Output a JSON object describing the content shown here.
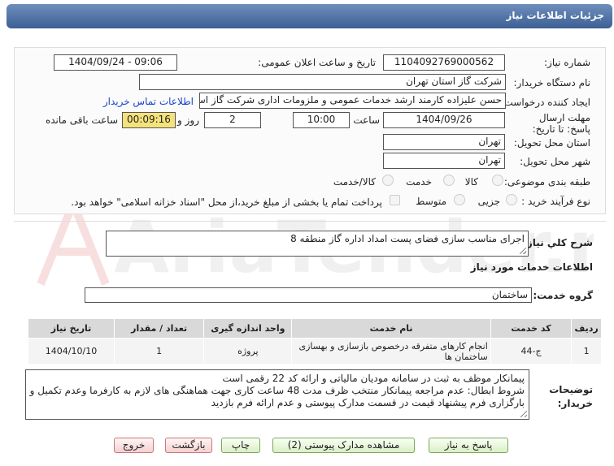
{
  "header": {
    "title": "جزئیات اطلاعات نیاز"
  },
  "labels": {
    "need_number": "شماره نیاز:",
    "announce_datetime": "تاریخ و ساعت اعلان عمومی:",
    "buyer_org": "نام دستگاه خریدار:",
    "creator": "ایجاد کننده درخواست:",
    "contact_link": "اطلاعات تماس خریدار",
    "deadline": "مهلت ارسال پاسخ: تا تاریخ:",
    "hour": "ساعت",
    "day_and": "روز و",
    "remaining": "ساعت باقی مانده",
    "province": "استان محل تحویل:",
    "city": "شهر محل تحویل:",
    "category": "طبقه بندی موضوعی:",
    "process_type": "نوع فرآیند خرید :",
    "general_desc": "شرح کلي نياز:",
    "services_info": "اطلاعات خدمات مورد نیاز",
    "service_group": "گروه خدمت:",
    "buyer_notes": "توضیحات خریدار:"
  },
  "values": {
    "need_number": "1104092769000562",
    "announce_datetime": "1404/09/24 - 09:06",
    "buyer_org": "شرکت گاز استان تهران",
    "creator": "حسن علیزاده کارمند ارشد خدمات عمومی و ملزومات اداری شرکت گاز استان تهران",
    "deadline_date": "1404/09/26",
    "deadline_hour": "10:00",
    "days": "2",
    "remaining_time": "00:09:16",
    "province": "تهران",
    "city": "تهران",
    "general_desc": "اجرای مناسب سازی فضای پست امداد اداره گاز منطقه 8",
    "service_group": "ساختمان",
    "buyer_notes_line1": "پیمانکار موظف به ثبت در سامانه مودیان مالیاتی و ارائه کد 22 رقمی است",
    "buyer_notes_line2": "شروط ابطال: عدم مراجعه پیمانکار منتخب ظرف مدت 48 ساعت کاری جهت هماهنگی های لازم به کارفرما وعدم تکمیل و",
    "buyer_notes_line3": "بارگزاری فرم پیشنهاد قیمت در قسمت مدارک پیوستی و عدم ارائه فرم بازدید"
  },
  "category_options": [
    "کالا",
    "خدمت",
    "کالا/خدمت"
  ],
  "process_options": [
    "جزیی",
    "متوسط"
  ],
  "payment_note": "پرداخت تمام یا بخشی از مبلغ خرید،از محل \"اسناد خزانه اسلامی\" خواهد بود.",
  "table": {
    "headers": [
      "ردیف",
      "کد خدمت",
      "نام خدمت",
      "واحد اندازه گیری",
      "تعداد / مقدار",
      "تاریخ نیاز"
    ],
    "rows": [
      [
        "1",
        "ج-44",
        "انجام کارهای متفرقه درخصوص بازسازی و بهسازی ساختمان ها",
        "پروژه",
        "1",
        "1404/10/10"
      ]
    ]
  },
  "buttons": {
    "respond": "پاسخ به نیاز",
    "view_docs": "مشاهده مدارک پیوستی (2)",
    "print": "چاپ",
    "back": "بازگشت",
    "exit": "خروج"
  },
  "watermark": "AriaTender.net"
}
